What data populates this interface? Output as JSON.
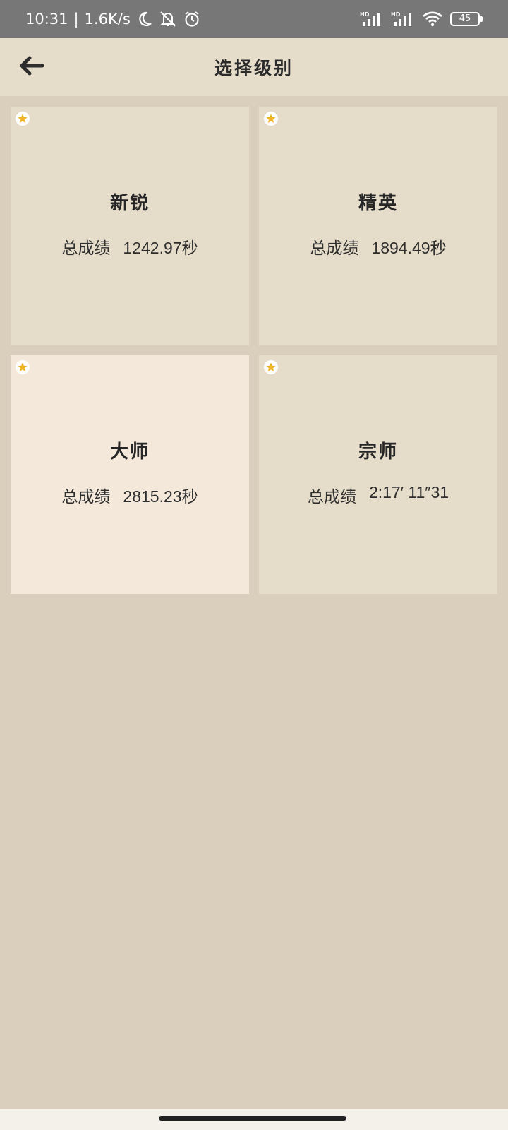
{
  "status_bar": {
    "time": "10:31",
    "separator": "|",
    "net_speed": "1.6K/s",
    "battery": "45",
    "icons": [
      "moon-icon",
      "bell-off-icon",
      "alarm-icon",
      "signal-hd-icon",
      "signal-hd-icon",
      "wifi-icon",
      "battery-icon"
    ]
  },
  "app_bar": {
    "title": "选择级别",
    "back_icon": "arrow-left-icon"
  },
  "levels": [
    {
      "name": "新锐",
      "score_label": "总成绩",
      "score": "1242.97秒",
      "selected": false
    },
    {
      "name": "精英",
      "score_label": "总成绩",
      "score": "1894.49秒",
      "selected": false
    },
    {
      "name": "大师",
      "score_label": "总成绩",
      "score": "2815.23秒",
      "selected": true
    },
    {
      "name": "宗师",
      "score_label": "总成绩",
      "score": "2:17′ 11″31",
      "selected": false
    }
  ],
  "colors": {
    "background": "#dacfbc",
    "card": "#e6dcca",
    "card_selected": "#f3e8d9",
    "star": "#f0b429",
    "status_bar": "#777777"
  }
}
